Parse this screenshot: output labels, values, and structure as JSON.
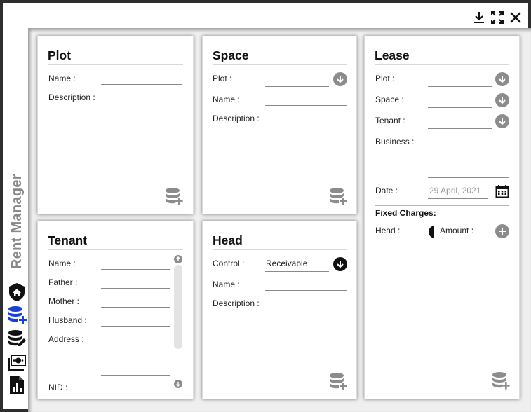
{
  "window": {
    "title": "Rent Manager",
    "buttons": [
      "download-icon",
      "fullscreen-icon",
      "close-icon"
    ]
  },
  "nav": [
    "home-icon",
    "database-add-icon",
    "database-edit-icon",
    "cash-icon",
    "report-icon"
  ],
  "plot": {
    "title": "Plot",
    "name_label": "Name :",
    "description_label": "Description :"
  },
  "space": {
    "title": "Space",
    "plot_label": "Plot :",
    "name_label": "Name :",
    "description_label": "Description :"
  },
  "lease": {
    "title": "Lease",
    "plot_label": "Plot :",
    "space_label": "Space :",
    "tenant_label": "Tenant :",
    "business_label": "Business :",
    "date_label": "Date :",
    "date_value": "29 April, 2021",
    "fixed_charges_label": "Fixed Charges:",
    "head_label": "Head :",
    "amount_label": "Amount :"
  },
  "tenant": {
    "title": "Tenant",
    "name_label": "Name :",
    "father_label": "Father :",
    "mother_label": "Mother :",
    "husband_label": "Husband :",
    "address_label": "Address :",
    "nid_label": "NID :"
  },
  "head": {
    "title": "Head",
    "control_label": "Control :",
    "control_value": "Receivable",
    "name_label": "Name :",
    "description_label": "Description :"
  },
  "colors": {
    "accent": "#1a3fd6",
    "icon_grey": "#8c8c8c",
    "frame": "#2e2e2e"
  }
}
